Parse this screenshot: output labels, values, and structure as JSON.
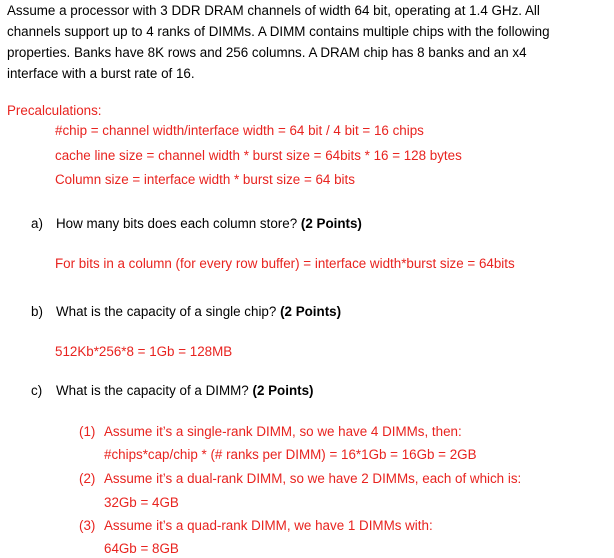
{
  "intro": {
    "line1": "Assume a processor with 3 DDR DRAM channels of width 64 bit, operating at 1.4 GHz. All",
    "line2": "channels support up to 4 ranks of DIMMs. A DIMM contains multiple chips with the following",
    "line3": "properties. Banks have 8K rows and 256 columns. A DRAM chip has 8 banks and an x4",
    "line4": "interface with a burst rate of 16."
  },
  "precalc": {
    "heading": "Precalculations:",
    "chip": "#chip = channel width/interface width = 64 bit / 4 bit = 16 chips",
    "cacheline": "cache line size = channel width * burst size = 64bits * 16 = 128 bytes",
    "column": "Column size = interface width * burst size = 64 bits"
  },
  "question_a": {
    "marker": "a)",
    "text": "How many bits does each column store?",
    "points": "(2 Points)",
    "answer": "For bits in a column (for every row buffer) = interface width*burst size = 64bits"
  },
  "question_b": {
    "marker": "b)",
    "text": "What is the capacity of a single chip?",
    "points": "(2 Points)",
    "answer": "512Kb*256*8 = 1Gb = 128MB"
  },
  "question_c": {
    "marker": "c)",
    "text": "What is the capacity of a DIMM?",
    "points": "(2 Points)",
    "answers": [
      {
        "num": "(1)",
        "line1": "Assume it’s a single-rank DIMM, so we have 4 DIMMs, then:",
        "line2": "#chips*cap/chip * (# ranks per DIMM) = 16*1Gb = 16Gb = 2GB"
      },
      {
        "num": "(2)",
        "line1": "Assume it’s a dual-rank DIMM, so we have 2 DIMMs, each of which is:",
        "line2": "32Gb = 4GB"
      },
      {
        "num": "(3)",
        "line1": "Assume it’s a quad-rank DIMM, we have 1 DIMMs with:",
        "line2": "64Gb = 8GB"
      }
    ]
  },
  "colors": {
    "answer_red": "#e8231f",
    "text_black": "#000000"
  }
}
